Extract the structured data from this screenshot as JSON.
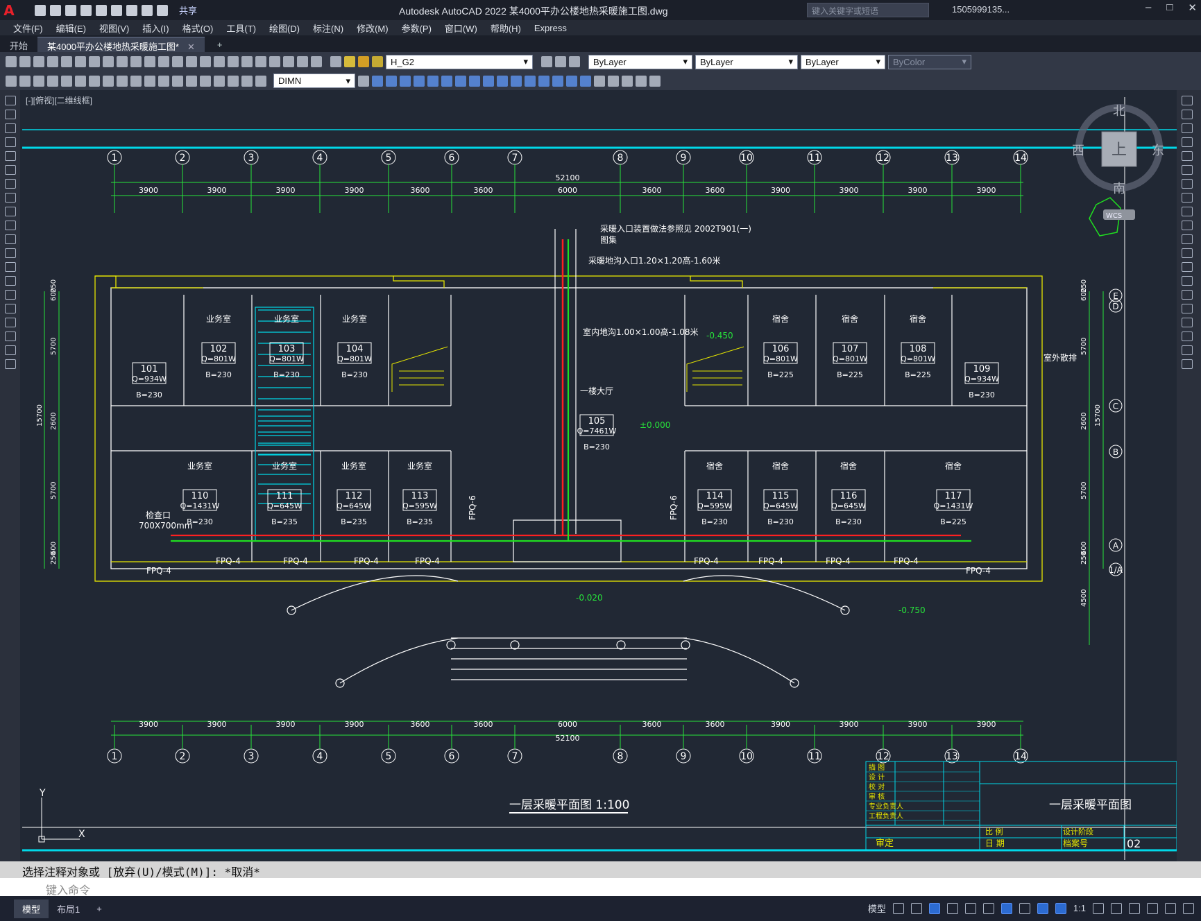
{
  "titlebar": {
    "app_title": "Autodesk AutoCAD 2022    某4000平办公楼地热采暖施工图.dwg",
    "share_label": "共享",
    "search_placeholder": "键入关键字或短语",
    "user_label": "1505999135..."
  },
  "menu": [
    "文件(F)",
    "编辑(E)",
    "视图(V)",
    "插入(I)",
    "格式(O)",
    "工具(T)",
    "绘图(D)",
    "标注(N)",
    "修改(M)",
    "参数(P)",
    "窗口(W)",
    "帮助(H)",
    "Express"
  ],
  "tabs": [
    {
      "label": "开始",
      "active": false
    },
    {
      "label": "某4000平办公楼地热采暖施工图*",
      "active": true
    }
  ],
  "toolbar": {
    "layer": "H_G2",
    "color": "ByLayer",
    "linetype": "ByLayer",
    "lineweight": "ByLayer",
    "plotstyle": "ByColor",
    "dimstyle": "DIMN"
  },
  "viewport": {
    "label": "[-][俯视][二维线框]",
    "viewcube": {
      "north": "北",
      "south": "南",
      "east": "东",
      "west": "西",
      "top": "上",
      "wcs": "WCS"
    }
  },
  "drawing": {
    "grid_top": [
      "1",
      "2",
      "3",
      "4",
      "5",
      "6",
      "7",
      "8",
      "9",
      "10",
      "11",
      "12",
      "13",
      "14"
    ],
    "spacings": [
      "3900",
      "3900",
      "3900",
      "3900",
      "3600",
      "3600",
      "6000",
      "3600",
      "3600",
      "3900",
      "3900",
      "3900",
      "3900"
    ],
    "total": "52100",
    "axes_right": [
      "E",
      "D",
      "C",
      "B",
      "A",
      "1/A"
    ],
    "dims_left": [
      "250",
      "600",
      "5700",
      "15700",
      "2600",
      "5700",
      "600",
      "250"
    ],
    "dims_right": [
      "250",
      "600",
      "5700",
      "2600",
      "15700",
      "5700",
      "600",
      "250",
      "4500"
    ],
    "rooms": [
      {
        "id": "101",
        "q": "Q=934W",
        "b": "B=230",
        "name": ""
      },
      {
        "id": "102",
        "q": "Q=801W",
        "b": "B=230",
        "name": "业务室"
      },
      {
        "id": "103",
        "q": "Q=801W",
        "b": "B=230",
        "name": "业务室"
      },
      {
        "id": "104",
        "q": "Q=801W",
        "b": "B=230",
        "name": "业务室"
      },
      {
        "id": "105",
        "q": "Q=7461W",
        "b": "B=230",
        "name": "一楼大厅"
      },
      {
        "id": "106",
        "q": "Q=801W",
        "b": "B=225",
        "name": "宿舍"
      },
      {
        "id": "107",
        "q": "Q=801W",
        "b": "B=225",
        "name": "宿舍"
      },
      {
        "id": "108",
        "q": "Q=801W",
        "b": "B=225",
        "name": "宿舍"
      },
      {
        "id": "109",
        "q": "Q=934W",
        "b": "B=230",
        "name": ""
      },
      {
        "id": "110",
        "q": "Q=1431W",
        "b": "B=230",
        "name": "业务室"
      },
      {
        "id": "111",
        "q": "Q=645W",
        "b": "B=235",
        "name": "业务室"
      },
      {
        "id": "112",
        "q": "Q=645W",
        "b": "B=235",
        "name": "业务室"
      },
      {
        "id": "113",
        "q": "Q=595W",
        "b": "B=235",
        "name": "业务室"
      },
      {
        "id": "114",
        "q": "Q=595W",
        "b": "B=230",
        "name": "宿舍"
      },
      {
        "id": "115",
        "q": "Q=645W",
        "b": "B=230",
        "name": "宿舍"
      },
      {
        "id": "116",
        "q": "Q=645W",
        "b": "B=230",
        "name": "宿舍"
      },
      {
        "id": "117",
        "q": "Q=1431W",
        "b": "B=225",
        "name": "宿舍"
      }
    ],
    "annotations": {
      "entry_note": "采暖入口装置做法参照见 2002T901(一)",
      "entry_note2": "图集",
      "trench": "采暖地沟入口1.20×1.20高-1.60米",
      "pit": "室内地沟1.00×1.00高-1.08米",
      "level_1": "-0.450",
      "level_2": "±0.000",
      "level_3": "-0.020",
      "level_4": "-0.750",
      "inspection": "检查口",
      "inspection_size": "700X700mm",
      "outdoor": "室外散排",
      "fpq4": "FPQ-4",
      "fpq6": "FPQ-6"
    },
    "drawing_title": "一层采暖平面图 1:100",
    "titleblock": {
      "rows": [
        "描 图",
        "设 计",
        "校 对",
        "审 核",
        "专业负责人",
        "工程负责人"
      ],
      "approve": "审定",
      "scale_label": "比 例",
      "date_label": "日 期",
      "stage_label": "设计阶段",
      "file_label": "档案号",
      "sheet_title": "一层采暖平面图",
      "sheet_no": "02"
    },
    "ucs": {
      "x": "X",
      "y": "Y"
    }
  },
  "command": {
    "history": "选择注释对象或 [放弃(U)/模式(M)]: *取消*",
    "placeholder": "键入命令"
  },
  "status": {
    "layout_tabs": [
      "模型",
      "布局1"
    ],
    "model_label": "模型",
    "scale": "1:1"
  },
  "colors": {
    "grid": "#27e43a",
    "wall": "#e8e800",
    "structure": "#ffffff",
    "supply_pipe": "#ff2020",
    "return_pipe": "#20e020",
    "floor_heating": "#00d8e8",
    "frame": "#00d8e8"
  }
}
